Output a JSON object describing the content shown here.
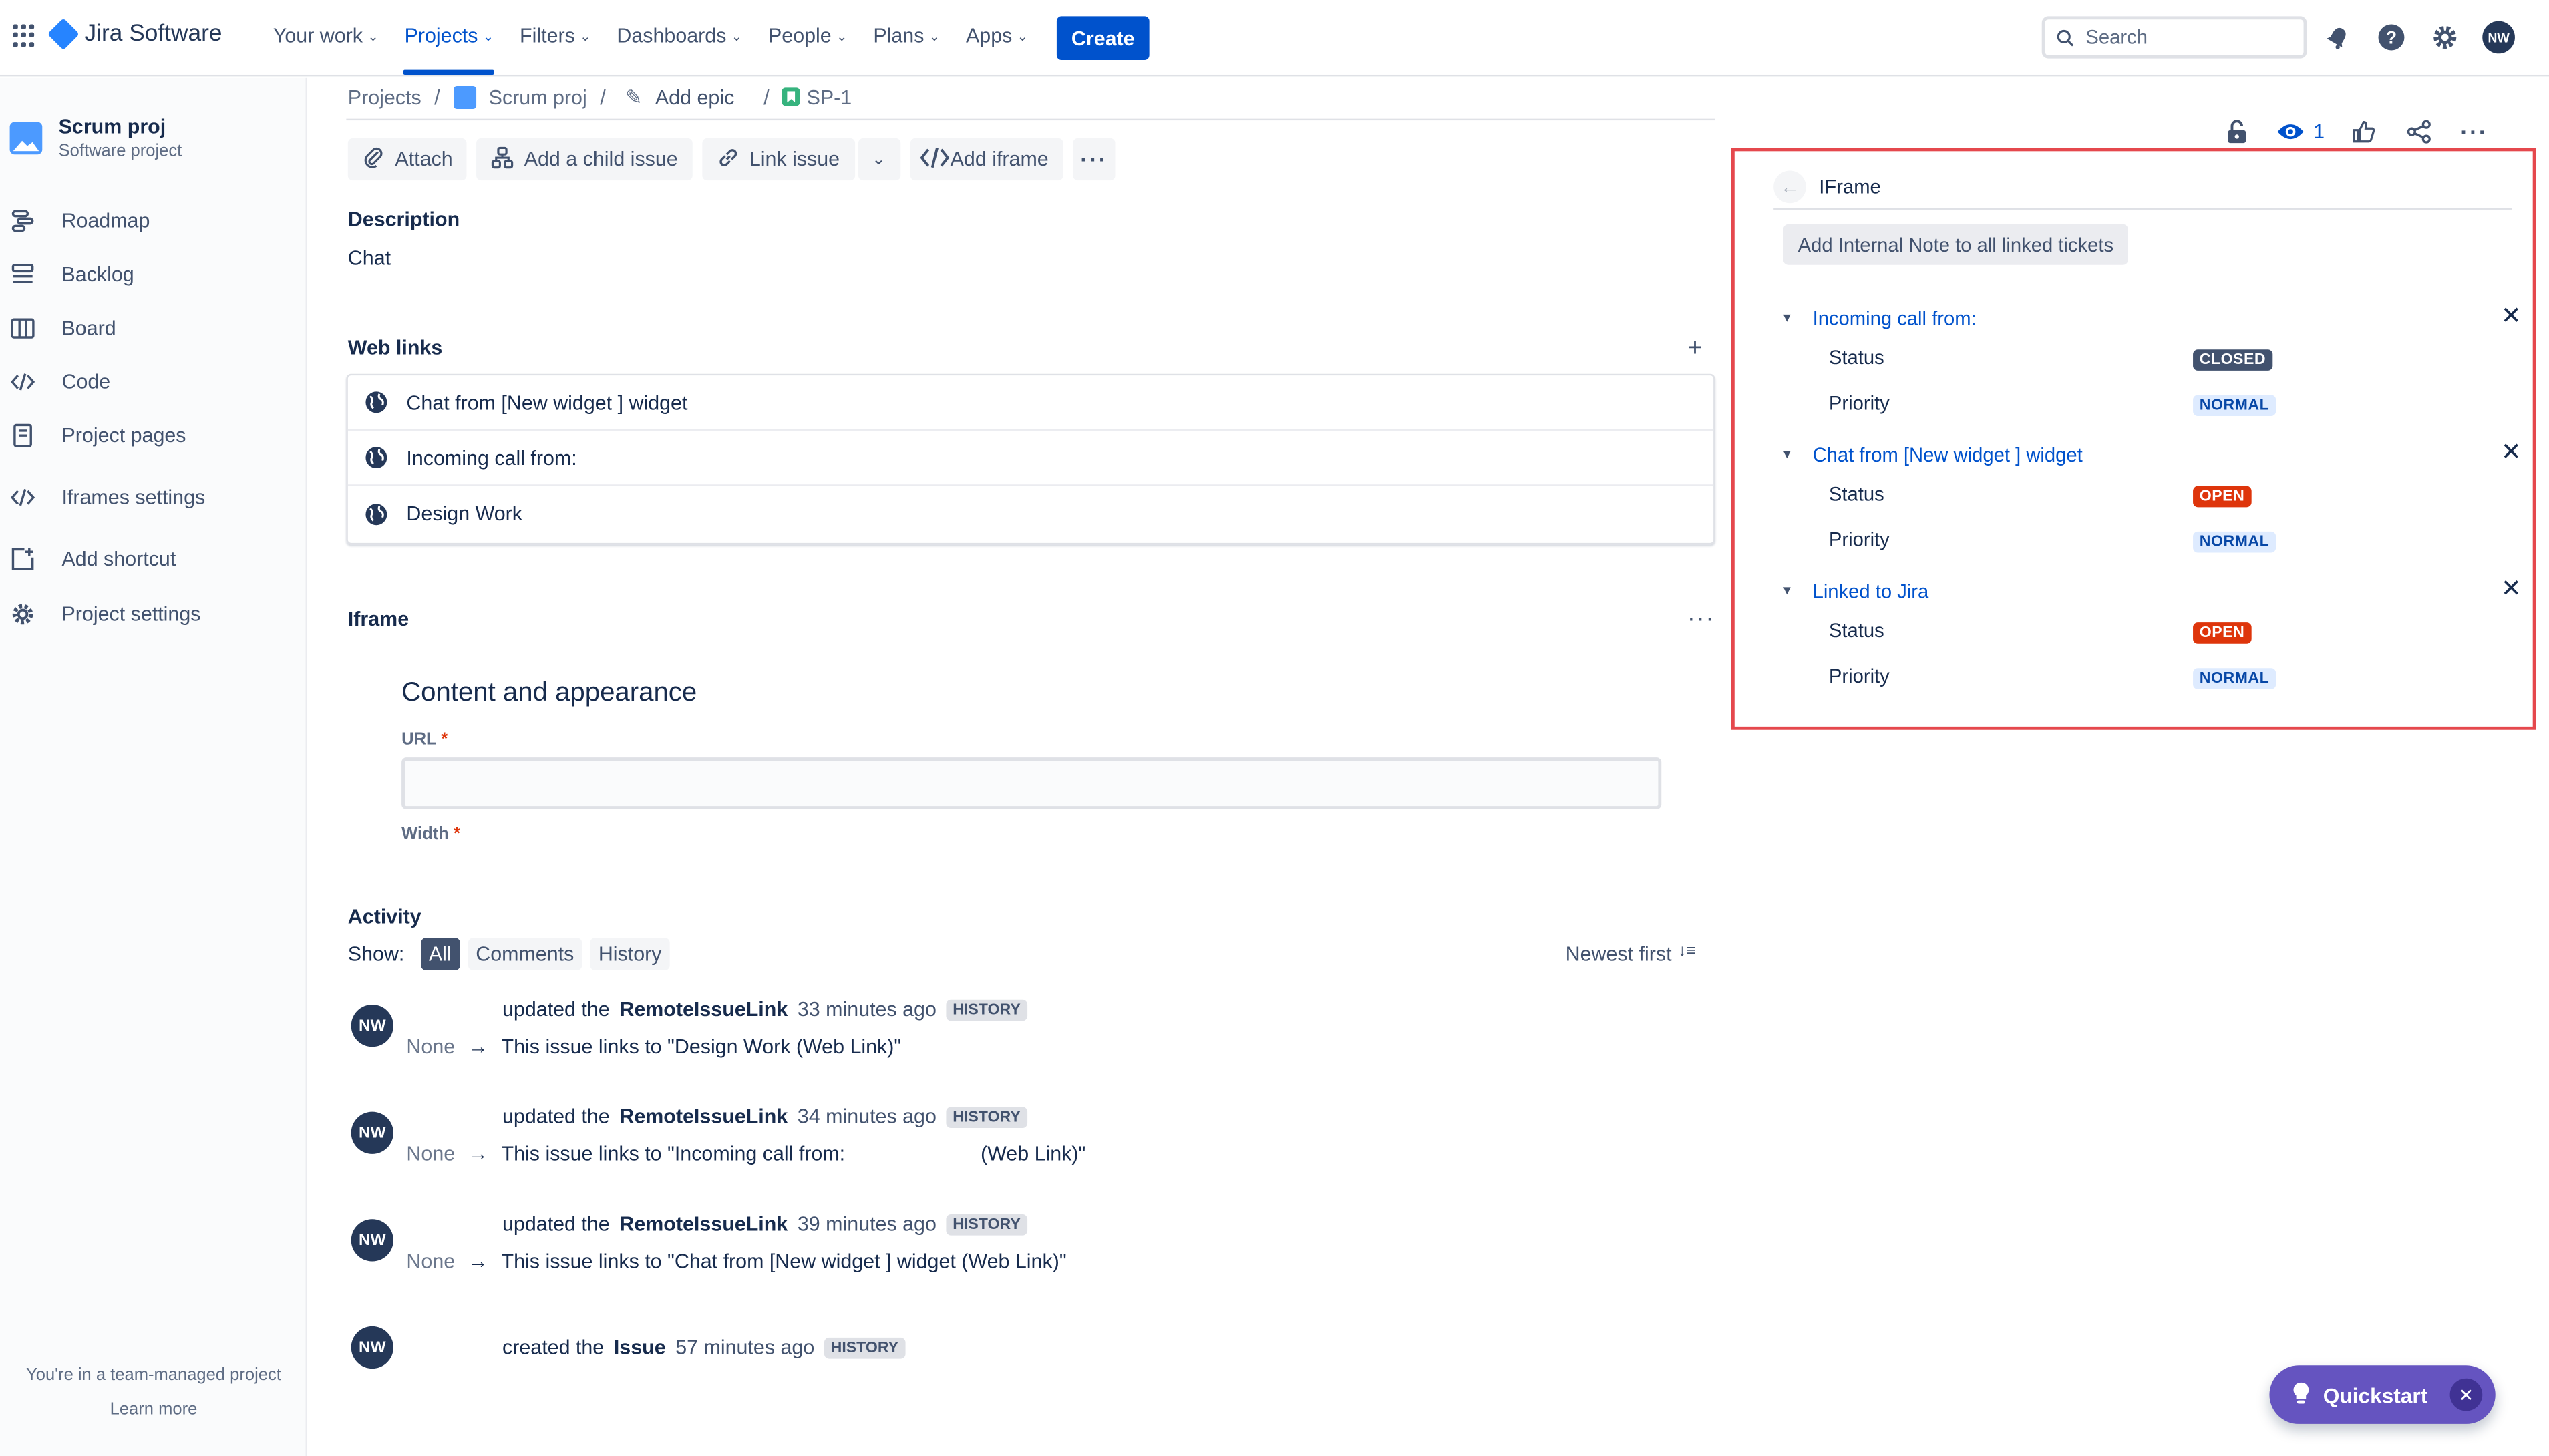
{
  "topnav": {
    "logo": "Jira Software",
    "menu": [
      {
        "label": "Your work",
        "active": false
      },
      {
        "label": "Projects",
        "active": true
      },
      {
        "label": "Filters",
        "active": false
      },
      {
        "label": "Dashboards",
        "active": false
      },
      {
        "label": "People",
        "active": false
      },
      {
        "label": "Plans",
        "active": false
      },
      {
        "label": "Apps",
        "active": false
      }
    ],
    "create_label": "Create",
    "search_placeholder": "Search",
    "avatar_initials": "NW",
    "icons": [
      "bell-icon",
      "help-icon",
      "settings-icon"
    ]
  },
  "sidebar": {
    "project_name": "Scrum proj",
    "project_type": "Software project",
    "items": [
      {
        "label": "Roadmap",
        "icon": "roadmap-icon"
      },
      {
        "label": "Backlog",
        "icon": "backlog-icon"
      },
      {
        "label": "Board",
        "icon": "board-icon"
      },
      {
        "label": "Code",
        "icon": "code-icon"
      },
      {
        "label": "Project pages",
        "icon": "pages-icon"
      },
      {
        "label": "Iframes settings",
        "icon": "code-icon"
      },
      {
        "label": "Add shortcut",
        "icon": "add-shortcut-icon"
      },
      {
        "label": "Project settings",
        "icon": "gear-icon"
      }
    ],
    "footer_text": "You're in a team-managed project",
    "footer_link": "Learn more"
  },
  "breadcrumb": {
    "projects": "Projects",
    "project": "Scrum proj",
    "epic": "Add epic",
    "issue": "SP-1"
  },
  "toolbar": {
    "attach": "Attach",
    "add_child": "Add a child issue",
    "link_issue": "Link issue",
    "add_iframe": "Add iframe"
  },
  "description": {
    "title": "Description",
    "text": "Chat"
  },
  "weblinks": {
    "title": "Web links",
    "items": [
      "Chat from [New widget ] widget",
      "Incoming call from:",
      "Design Work"
    ]
  },
  "iframe_section": {
    "title": "Iframe",
    "heading": "Content and appearance",
    "url_label": "URL",
    "width_label": "Width",
    "required_mark": "*"
  },
  "activity": {
    "title": "Activity",
    "show_label": "Show:",
    "filters": [
      "All",
      "Comments",
      "History"
    ],
    "sort_label": "Newest first",
    "entries": [
      {
        "avatar": "NW",
        "action": "updated the",
        "object": "RemoteIssueLink",
        "time": "33 minutes ago",
        "badge": "HISTORY",
        "from": "None",
        "to": "This issue links to \"Design Work (Web Link)\""
      },
      {
        "avatar": "NW",
        "action": "updated the",
        "object": "RemoteIssueLink",
        "time": "34 minutes ago",
        "badge": "HISTORY",
        "from": "None",
        "to": "This issue links to \"Incoming call from:                        (Web Link)\""
      },
      {
        "avatar": "NW",
        "action": "updated the",
        "object": "RemoteIssueLink",
        "time": "39 minutes ago",
        "badge": "HISTORY",
        "from": "None",
        "to": "This issue links to \"Chat from [New widget ] widget (Web Link)\""
      },
      {
        "avatar": "NW",
        "action": "created the",
        "object": "Issue",
        "time": "57 minutes ago",
        "badge": "HISTORY"
      }
    ]
  },
  "right": {
    "watch_count": "1",
    "panel_title": "IFrame",
    "note_button": "Add Internal Note to all linked tickets",
    "status_label": "Status",
    "priority_label": "Priority",
    "tickets": [
      {
        "title": "Incoming call from:",
        "status": "CLOSED",
        "priority": "NORMAL"
      },
      {
        "title": "Chat from [New widget ] widget",
        "status": "OPEN",
        "priority": "NORMAL"
      },
      {
        "title": "Linked to Jira",
        "status": "OPEN",
        "priority": "NORMAL"
      }
    ],
    "colors": {
      "closed": "#42526E",
      "open": "#DE350B",
      "normal_bg": "#DEEBFF",
      "highlight_border": "#E5484D"
    }
  },
  "quickstart": {
    "label": "Quickstart"
  }
}
